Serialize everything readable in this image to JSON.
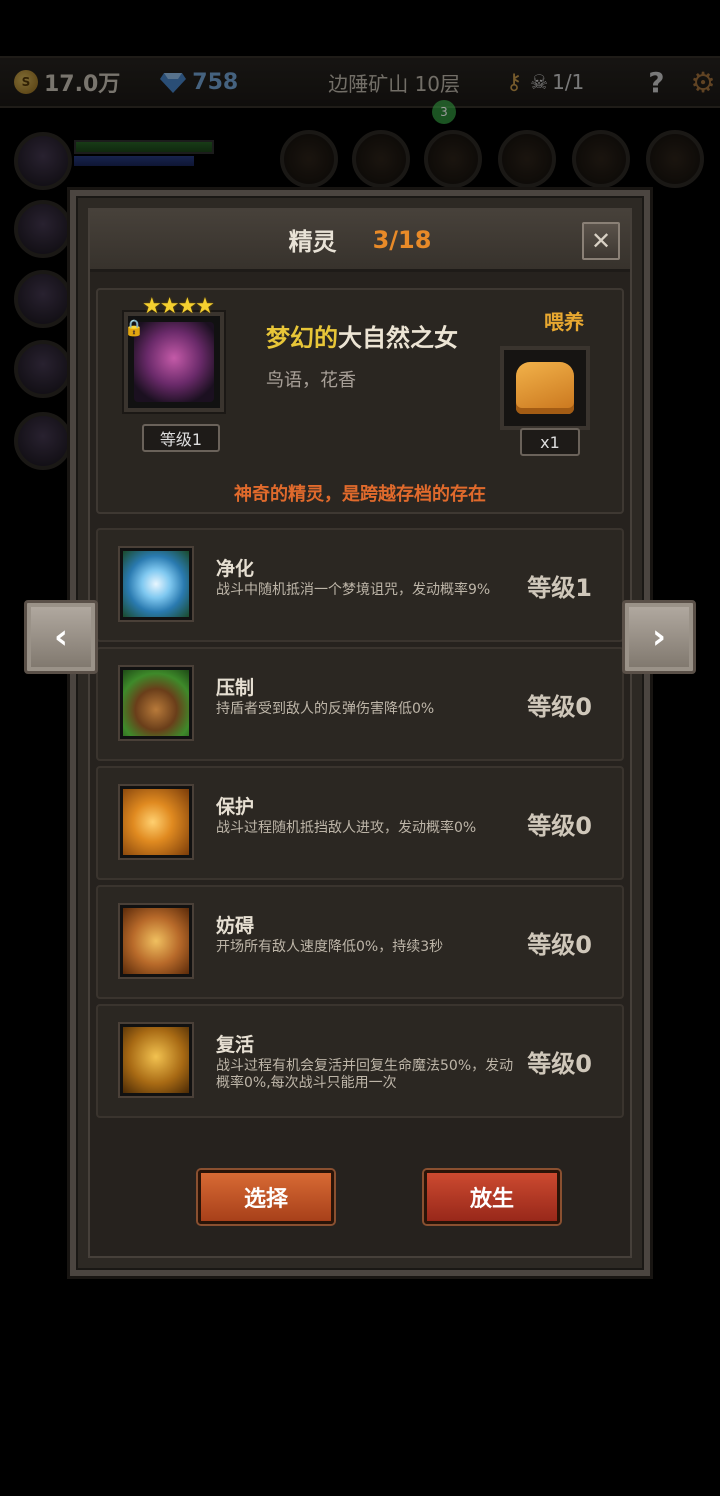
{
  "hud": {
    "gold": "17.0万",
    "coin_icon_glyph": "S",
    "gems": "758",
    "floor": "边陲矿山 10层",
    "kills": "1/1",
    "help": "?",
    "green_badge": "3"
  },
  "panel": {
    "title": "精灵",
    "count": "3/18",
    "close": "✕"
  },
  "sprite": {
    "stars": "★★★★",
    "level": "等级1",
    "name_prefix": "梦幻的",
    "name_main": "大自然之女",
    "tags": "鸟语，花香",
    "feed_label": "喂养",
    "feed_qty": "x1",
    "description": "神奇的精灵，是跨越存档的存在"
  },
  "skills": [
    {
      "name": "净化",
      "desc": "战斗中随机抵消一个梦境诅咒，发动概率9%",
      "level": "等级1",
      "icon": "blue-flower-icon"
    },
    {
      "name": "压制",
      "desc": "持盾者受到敌人的反弹伤害降低0%",
      "level": "等级0",
      "icon": "beast-claw-icon"
    },
    {
      "name": "保护",
      "desc": "战斗过程随机抵挡敌人进攻，发动概率0%",
      "level": "等级0",
      "icon": "fairy-protect-icon"
    },
    {
      "name": "妨碍",
      "desc": "开场所有敌人速度降低0%，持续3秒",
      "level": "等级0",
      "icon": "chained-boot-icon"
    },
    {
      "name": "复活",
      "desc": "战斗过程有机会复活并回复生命魔法50%，发动概率0%,每次战斗只能用一次",
      "level": "等级0",
      "icon": "revive-dancer-icon"
    }
  ],
  "buttons": {
    "select": "选择",
    "release": "放生"
  },
  "nav": {
    "prev": "‹",
    "next": "›"
  }
}
